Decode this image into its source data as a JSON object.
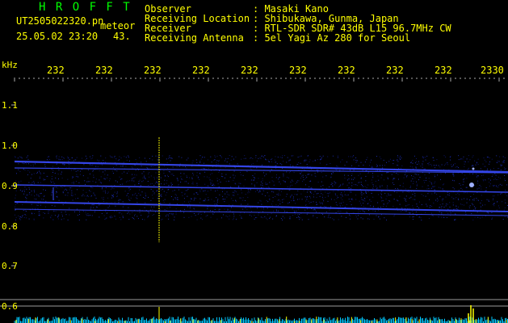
{
  "header": {
    "program_title": "H R O F F T",
    "filename": "UT2505022320.pn",
    "meteor_label": "meteor",
    "timestamp": "25.05.02 23:20",
    "meteor_count": "43.",
    "observer_label": "Observer",
    "observer_value": ": Masaki Kano",
    "location_label": "Receiving Location",
    "location_value": ": Shibukawa, Gunma, Japan",
    "receiver_label": "Receiver",
    "receiver_value": ": RTL-SDR SDR# 43dB L15 96.7MHz CW",
    "antenna_label": "Receiving Antenna",
    "antenna_value": ": 5el Yagi Az 280 for Seoul"
  },
  "axes": {
    "y_unit": "kHz",
    "y_ticks": [
      "1.1",
      "1.0",
      "0.9",
      "0.8",
      "0.7",
      "0.6"
    ],
    "x_ticks": [
      "232",
      "232",
      "232",
      "232",
      "232",
      "232",
      "232",
      "232",
      "232",
      "2330"
    ]
  },
  "colors": {
    "background": "#000000",
    "text": "#ffff00",
    "title": "#00ff00",
    "signal": "#3a4cff",
    "signal_bright": "#9fb0ff",
    "bottom_strip": "#00c8ff",
    "bottom_spike": "#ffff00"
  }
}
